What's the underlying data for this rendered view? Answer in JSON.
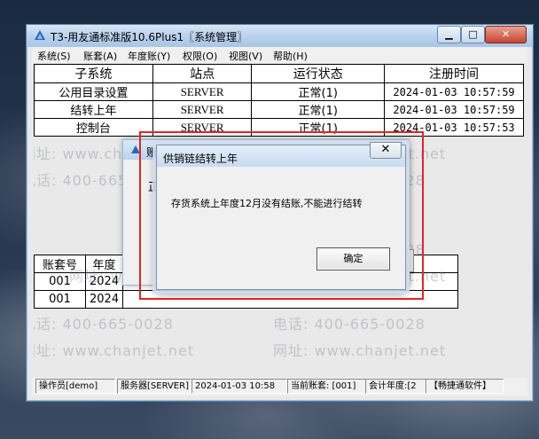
{
  "window": {
    "title": "T3-用友通标准版10.6Plus1〖系统管理〗",
    "controls": {
      "minimize": "▁",
      "maximize": "□",
      "close": "✕"
    }
  },
  "menu": [
    "系统(S)",
    "账套(A)",
    "年度账(Y)",
    "权限(O)",
    "视图(V)",
    "帮助(H)"
  ],
  "subsystem_table": {
    "headers": [
      "子系统",
      "站点",
      "运行状态",
      "注册时间"
    ],
    "rows": [
      [
        "公用目录设置",
        "SERVER",
        "正常(1)",
        "2024-01-03 10:57:59"
      ],
      [
        "结转上年",
        "SERVER",
        "正常(1)",
        "2024-01-03 10:57:59"
      ],
      [
        "控制台",
        "SERVER",
        "正常(1)",
        "2024-01-03 10:57:53"
      ]
    ]
  },
  "account_table": {
    "headers": [
      "账套号",
      "年度"
    ],
    "rows": [
      [
        "001",
        "2024"
      ],
      [
        "001",
        "2024"
      ]
    ]
  },
  "watermark": {
    "phone": "电话: 400-665-0028",
    "site": "网址: www.chanjet.net"
  },
  "status_bar": {
    "operator": "操作员[demo]",
    "server": "服务器[SERVER]",
    "time": "2024-01-03 10:58",
    "account": "当前账套: [001]",
    "fiscal_year": "会计年度:[2",
    "brand": "【畅捷通软件】"
  },
  "back_dialog": {
    "title": "账",
    "text": "正",
    "close": "✕"
  },
  "message_dialog": {
    "title": "供销链结转上年",
    "message": "存货系统上年度12月没有结账,不能进行结转",
    "ok_label": "确定",
    "close": "✕"
  },
  "colors": {
    "highlight_box": "#e02626",
    "titlebar": "#b9d2ec"
  }
}
